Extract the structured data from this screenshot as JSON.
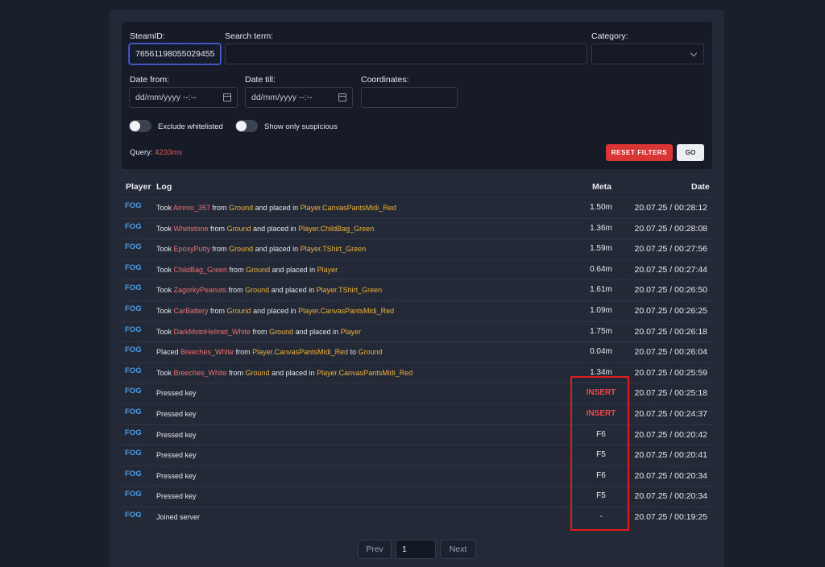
{
  "filters": {
    "steamid": {
      "label": "SteamID:",
      "value": "76561198055029455"
    },
    "search": {
      "label": "Search term:",
      "value": ""
    },
    "category": {
      "label": "Category:",
      "value": ""
    },
    "date_from": {
      "label": "Date from:",
      "placeholder": "dd/mm/yyyy --:--"
    },
    "date_till": {
      "label": "Date till:",
      "placeholder": "dd/mm/yyyy --:--"
    },
    "coordinates": {
      "label": "Coordinates:",
      "value": ""
    },
    "exclude_whitelisted": {
      "label": "Exclude whitelisted",
      "checked": false
    },
    "show_suspicious": {
      "label": "Show only suspicious",
      "checked": false
    },
    "query": {
      "label": "Query:",
      "value": "4233ms"
    },
    "reset_label": "RESET FILTERS",
    "go_label": "GO"
  },
  "table": {
    "headers": {
      "player": "Player",
      "log": "Log",
      "meta": "Meta",
      "date": "Date"
    },
    "rows": [
      {
        "player": "FOG",
        "log": [
          [
            "Took ",
            "t"
          ],
          [
            "Ammo_357",
            "item"
          ],
          [
            " from ",
            "t"
          ],
          [
            "Ground",
            "loc"
          ],
          [
            " and placed in ",
            "t"
          ],
          [
            "Player.CanvasPantsMidi_Red",
            "loc"
          ]
        ],
        "meta": "1.50m",
        "date": "20.07.25 / 00:28:12"
      },
      {
        "player": "FOG",
        "log": [
          [
            "Took ",
            "t"
          ],
          [
            "Whetstone",
            "item"
          ],
          [
            " from ",
            "t"
          ],
          [
            "Ground",
            "loc"
          ],
          [
            " and placed in ",
            "t"
          ],
          [
            "Player.ChildBag_Green",
            "loc"
          ]
        ],
        "meta": "1.36m",
        "date": "20.07.25 / 00:28:08"
      },
      {
        "player": "FOG",
        "log": [
          [
            "Took ",
            "t"
          ],
          [
            "EpoxyPutty",
            "item"
          ],
          [
            " from ",
            "t"
          ],
          [
            "Ground",
            "loc"
          ],
          [
            " and placed in ",
            "t"
          ],
          [
            "Player.TShirt_Green",
            "loc"
          ]
        ],
        "meta": "1.59m",
        "date": "20.07.25 / 00:27:56"
      },
      {
        "player": "FOG",
        "log": [
          [
            "Took ",
            "t"
          ],
          [
            "ChildBag_Green",
            "item"
          ],
          [
            " from ",
            "t"
          ],
          [
            "Ground",
            "loc"
          ],
          [
            " and placed in ",
            "t"
          ],
          [
            "Player",
            "loc"
          ]
        ],
        "meta": "0.64m",
        "date": "20.07.25 / 00:27:44"
      },
      {
        "player": "FOG",
        "log": [
          [
            "Took ",
            "t"
          ],
          [
            "ZagorkyPeanuts",
            "item"
          ],
          [
            " from ",
            "t"
          ],
          [
            "Ground",
            "loc"
          ],
          [
            " and placed in ",
            "t"
          ],
          [
            "Player.TShirt_Green",
            "loc"
          ]
        ],
        "meta": "1.61m",
        "date": "20.07.25 / 00:26:50"
      },
      {
        "player": "FOG",
        "log": [
          [
            "Took ",
            "t"
          ],
          [
            "CarBattery",
            "item"
          ],
          [
            " from ",
            "t"
          ],
          [
            "Ground",
            "loc"
          ],
          [
            " and placed in ",
            "t"
          ],
          [
            "Player.CanvasPantsMidi_Red",
            "loc"
          ]
        ],
        "meta": "1.09m",
        "date": "20.07.25 / 00:26:25"
      },
      {
        "player": "FOG",
        "log": [
          [
            "Took ",
            "t"
          ],
          [
            "DarkMotoHelmet_White",
            "item"
          ],
          [
            " from ",
            "t"
          ],
          [
            "Ground",
            "loc"
          ],
          [
            " and placed in ",
            "t"
          ],
          [
            "Player",
            "loc"
          ]
        ],
        "meta": "1.75m",
        "date": "20.07.25 / 00:26:18"
      },
      {
        "player": "FOG",
        "log": [
          [
            "Placed ",
            "t"
          ],
          [
            "Breeches_White",
            "item"
          ],
          [
            " from ",
            "t"
          ],
          [
            "Player.CanvasPantsMidi_Red",
            "loc"
          ],
          [
            " to ",
            "t"
          ],
          [
            "Ground",
            "loc"
          ]
        ],
        "meta": "0.04m",
        "date": "20.07.25 / 00:26:04"
      },
      {
        "player": "FOG",
        "log": [
          [
            "Took ",
            "t"
          ],
          [
            "Breeches_White",
            "item"
          ],
          [
            " from ",
            "t"
          ],
          [
            "Ground",
            "loc"
          ],
          [
            " and placed in ",
            "t"
          ],
          [
            "Player.CanvasPantsMidi_Red",
            "loc"
          ]
        ],
        "meta": "1.34m",
        "date": "20.07.25 / 00:25:59"
      },
      {
        "player": "FOG",
        "log": [
          [
            "Pressed key",
            "t"
          ]
        ],
        "meta": "INSERT",
        "meta_warn": true,
        "date": "20.07.25 / 00:25:18"
      },
      {
        "player": "FOG",
        "log": [
          [
            "Pressed key",
            "t"
          ]
        ],
        "meta": "INSERT",
        "meta_warn": true,
        "date": "20.07.25 / 00:24:37"
      },
      {
        "player": "FOG",
        "log": [
          [
            "Pressed key",
            "t"
          ]
        ],
        "meta": "F6",
        "date": "20.07.25 / 00:20:42"
      },
      {
        "player": "FOG",
        "log": [
          [
            "Pressed key",
            "t"
          ]
        ],
        "meta": "F5",
        "date": "20.07.25 / 00:20:41"
      },
      {
        "player": "FOG",
        "log": [
          [
            "Pressed key",
            "t"
          ]
        ],
        "meta": "F6",
        "date": "20.07.25 / 00:20:34"
      },
      {
        "player": "FOG",
        "log": [
          [
            "Pressed key",
            "t"
          ]
        ],
        "meta": "F5",
        "date": "20.07.25 / 00:20:34"
      },
      {
        "player": "FOG",
        "log": [
          [
            "Joined server",
            "t"
          ]
        ],
        "meta": "-",
        "date": "20.07.25 / 00:19:25"
      }
    ]
  },
  "pagination": {
    "prev_label": "Prev",
    "page": "1",
    "next_label": "Next"
  },
  "colors": {
    "accent_red": "#d93535",
    "player_blue": "#4c9ee8",
    "item_red": "#f07070",
    "location_orange": "#f0b23a",
    "highlight_red": "#e01c1c"
  }
}
